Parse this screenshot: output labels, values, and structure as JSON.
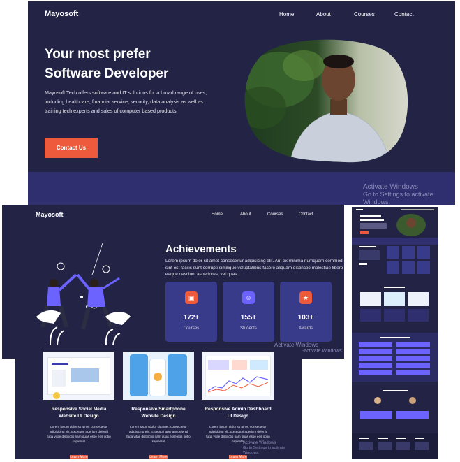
{
  "site": {
    "brand": "Mayosoft",
    "nav": [
      "Home",
      "About",
      "Courses",
      "Contact"
    ]
  },
  "hero": {
    "title_line1": "Your most prefer",
    "title_line2": "Software Developer",
    "description": "Mayosoft Tech offers software and IT solutions for a broad range of uses, including healthcare, financial service, security, data analysis as well as training tech experts and sales of computer based products.",
    "cta": "Contact Us"
  },
  "windows_watermark": {
    "title": "Activate Windows",
    "subtitle": "Go to Settings to activate Windows.",
    "short_title": "Activate Windows",
    "short_subtitle": "-activate Windows.",
    "faded_title": "Activate Windows",
    "faded_subtitle": "Go to Settings to activate Windows."
  },
  "achievements": {
    "title": "Achievements",
    "description": "Lorem ipsum dolor sit amet consectetur adipisicing elit. Aut ex minima numquam commodi sint est facilis sunt corrupti similique voluptatibus facere aliquam distinctio molestiae libero eaque nesciunt asperiores, vel quas.",
    "stats": [
      {
        "value": "172+",
        "label": "Courses",
        "color": "#ee5a3c"
      },
      {
        "value": "155+",
        "label": "Students",
        "color": "#6c63ff"
      },
      {
        "value": "103+",
        "label": "Awards",
        "color": "#ee5a3c"
      }
    ]
  },
  "courses": [
    {
      "title": "Responsive Social Media Website UI Design",
      "text": "Lorem ipsum dolor sit amet, consectetur adipisicing elit. Excepturi aperiam deleniti fuga vitae distinctio nam quas esse eos optio sapiente!",
      "button": "Learn More"
    },
    {
      "title": "Responsive Smartphone Website Design",
      "text": "Lorem ipsum dolor sit amet, consectetur adipisicing elit. Excepturi aperiam deleniti fuga vitae distinctio nam quas esse eos optio sapiente!",
      "button": "Learn More"
    },
    {
      "title": "Responsive Admin Dashboard UI Design",
      "text": "Lorem ipsum dolor sit amet, consectetur adipisicing elit. Excepturi aperiam deleniti fuga vitae distinctio nam quas esse eos optio sapiente!",
      "button": "Learn More"
    }
  ]
}
